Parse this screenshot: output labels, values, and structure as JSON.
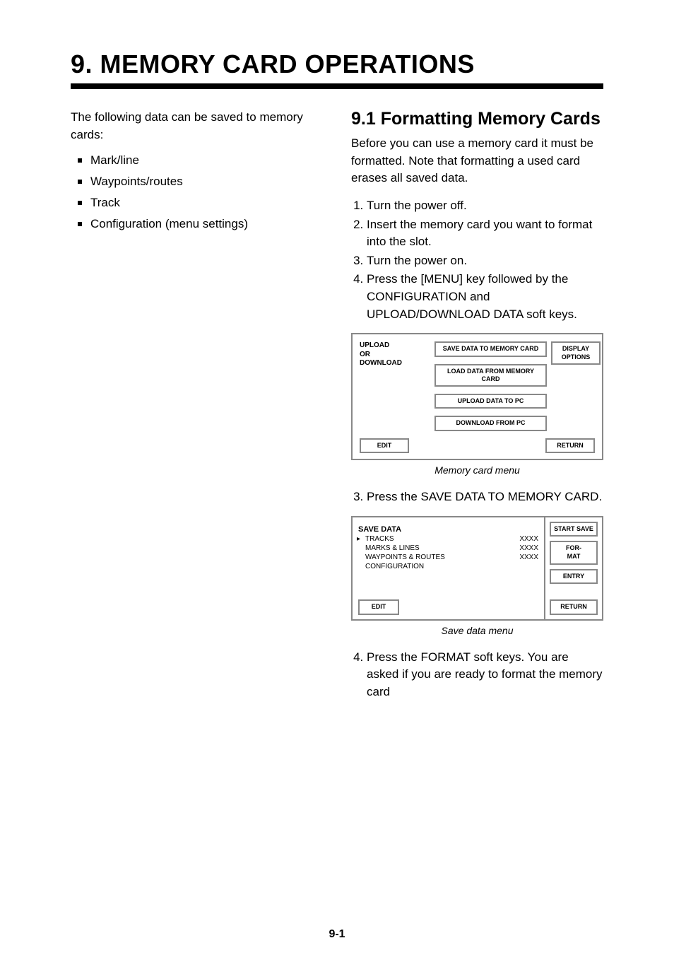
{
  "chapter_title": "9. MEMORY CARD OPERATIONS",
  "intro": "The following data can be saved to memory cards:",
  "data_bullets": [
    "Mark/line",
    "Waypoints/routes",
    "Track",
    "Configuration (menu settings)"
  ],
  "section9_1": {
    "title": "9.1 Formatting Memory Cards",
    "body": "Before you can use a memory card it must be formatted. Note that formatting a used card erases all saved data.",
    "steps_a": [
      "Turn the power off.",
      "Insert the memory card you want to format into the slot.",
      "Turn the power on.",
      "Press the [MENU] key followed by the CONFIGURATION and UPLOAD/DOWNLOAD DATA soft keys."
    ],
    "step3_text": "Press the SAVE DATA TO MEMORY CARD.",
    "step4_text": "Press the FORMAT soft keys. You are asked if you are ready to format the memory card"
  },
  "menu_diagram": {
    "left_label_line1": "UPLOAD",
    "left_label_line2": "OR",
    "left_label_line3": "DOWNLOAD",
    "top_right": "DISPLAY OPTIONS",
    "items": [
      "SAVE DATA TO MEMORY CARD",
      "LOAD DATA FROM MEMORY CARD",
      "UPLOAD DATA TO PC",
      "DOWNLOAD FROM PC"
    ],
    "edit": "EDIT",
    "return": "RETURN",
    "caption": "Memory card menu"
  },
  "save_diagram": {
    "title": "SAVE DATA",
    "tracks": "TRACKS",
    "tracks_xxxx": "XXXX",
    "marks": "MARKS & LINES",
    "marks_xxxx": "XXXX",
    "wpr": "WAYPOINTS & ROUTES",
    "wpr_xxxx": "XXXX",
    "config": "CONFIGURATION",
    "edit": "EDIT",
    "right": {
      "start": "START SAVE",
      "format": "FOR-\nMAT",
      "entry": "ENTRY",
      "return": "RETURN"
    },
    "caption": "Save data menu"
  },
  "page_number": "9-1"
}
